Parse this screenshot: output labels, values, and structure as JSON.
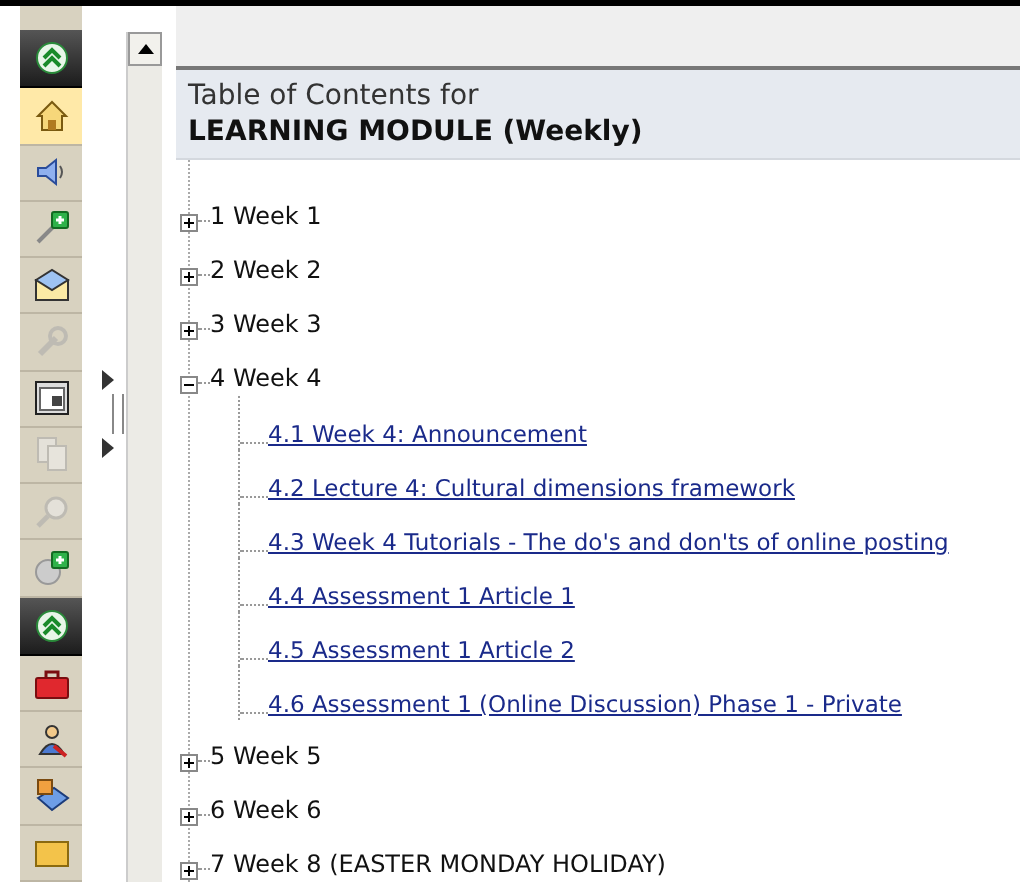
{
  "toolbar": {
    "groups": [
      {
        "expanded": true,
        "items": [
          {
            "selected": true,
            "disabled": false
          },
          {
            "selected": false,
            "disabled": false
          },
          {
            "selected": false,
            "disabled": false
          },
          {
            "selected": false,
            "disabled": false
          },
          {
            "selected": false,
            "disabled": true
          },
          {
            "selected": false,
            "disabled": false
          },
          {
            "selected": false,
            "disabled": true
          },
          {
            "selected": false,
            "disabled": true
          },
          {
            "selected": false,
            "disabled": false
          }
        ]
      },
      {
        "expanded": true,
        "items": [
          {
            "selected": false,
            "disabled": false
          },
          {
            "selected": false,
            "disabled": false
          },
          {
            "selected": false,
            "disabled": false
          },
          {
            "selected": false,
            "disabled": false
          }
        ]
      }
    ]
  },
  "toc": {
    "title": "Table of Contents for",
    "module": "LEARNING MODULE (Weekly)",
    "items": [
      {
        "label": "1 Week 1",
        "expanded": false
      },
      {
        "label": "2 Week 2",
        "expanded": false
      },
      {
        "label": "3 Week 3",
        "expanded": false
      },
      {
        "label": "4 Week 4",
        "expanded": true,
        "children": [
          {
            "label": "4.1 Week 4: Announcement"
          },
          {
            "label": "4.2 Lecture 4: Cultural dimensions framework"
          },
          {
            "label": "4.3 Week 4 Tutorials - The do's and don'ts of online posting"
          },
          {
            "label": "4.4 Assessment 1 Article 1"
          },
          {
            "label": "4.5 Assessment 1 Article 2"
          },
          {
            "label": "4.6 Assessment 1 (Online Discussion) Phase 1 - Private"
          }
        ]
      },
      {
        "label": "5 Week 5",
        "expanded": false
      },
      {
        "label": "6 Week 6",
        "expanded": false
      },
      {
        "label": "7 Week 8 (EASTER MONDAY HOLIDAY)",
        "expanded": false
      }
    ]
  }
}
